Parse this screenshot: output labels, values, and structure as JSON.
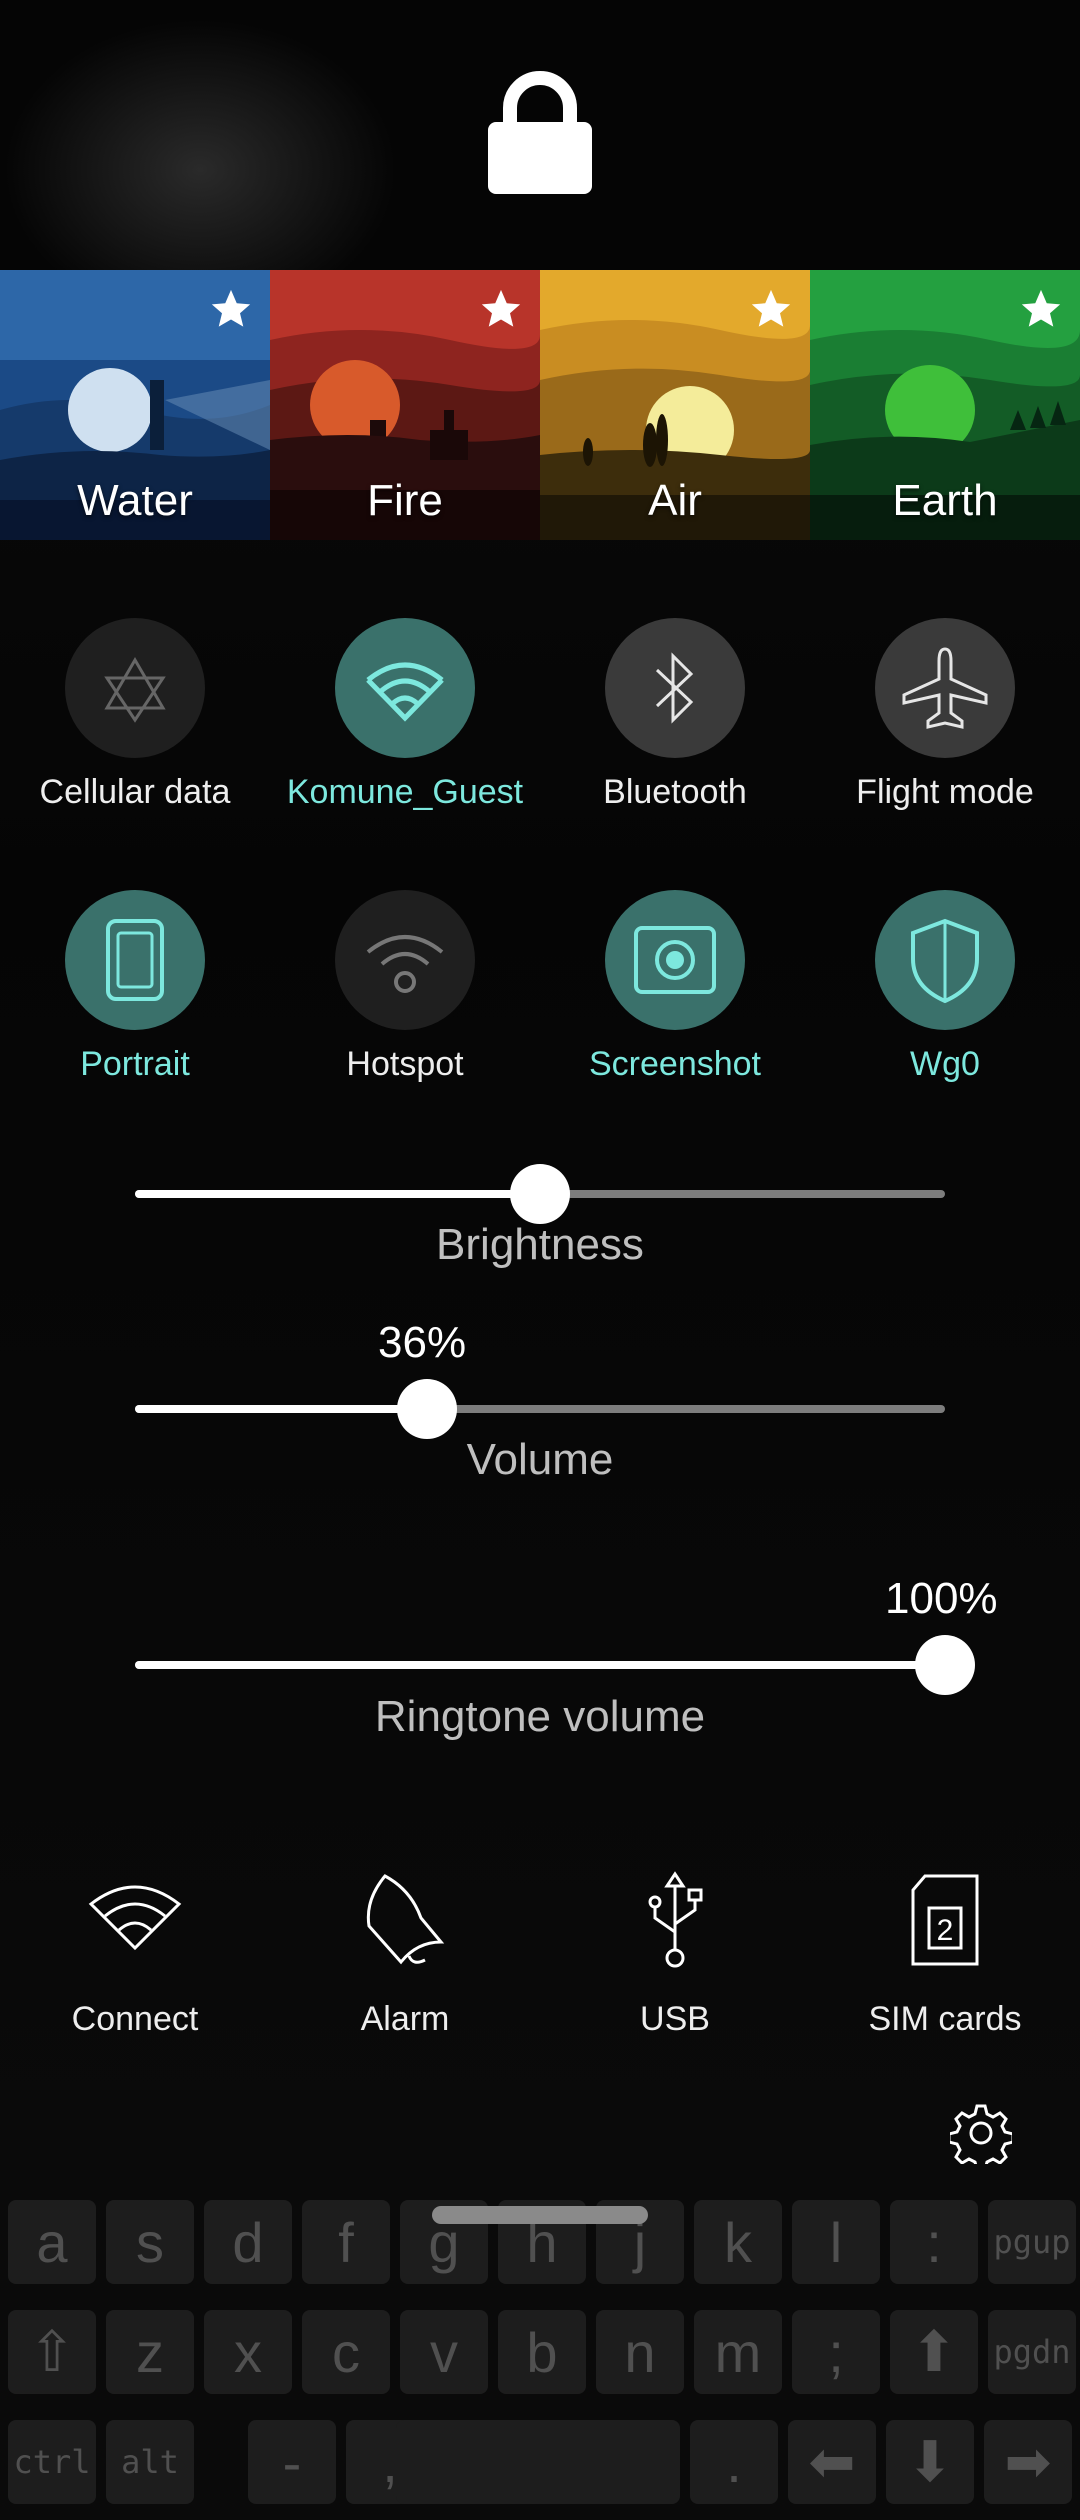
{
  "ambiences": [
    {
      "name": "Water",
      "colors": [
        "#1e3b66",
        "#0d1c33"
      ],
      "sun": "#cfe0f0"
    },
    {
      "name": "Fire",
      "colors": [
        "#a82a22",
        "#3a1010"
      ],
      "sun": "#e0622a"
    },
    {
      "name": "Air",
      "colors": [
        "#d9a12a",
        "#6a4a12"
      ],
      "sun": "#f4ec9a"
    },
    {
      "name": "Earth",
      "colors": [
        "#1f8a35",
        "#0c2a14"
      ],
      "sun": "#3fbf3a"
    }
  ],
  "quick_toggles": [
    {
      "label": "Cellular data",
      "icon": "cellular-data-icon",
      "state": "off"
    },
    {
      "label": "Komune_Guest",
      "icon": "wifi-icon",
      "state": "on"
    },
    {
      "label": "Bluetooth",
      "icon": "bluetooth-icon",
      "state": "dim"
    },
    {
      "label": "Flight mode",
      "icon": "flight-mode-icon",
      "state": "dim"
    },
    {
      "label": "Portrait",
      "icon": "portrait-icon",
      "state": "on"
    },
    {
      "label": "Hotspot",
      "icon": "hotspot-icon",
      "state": "off"
    },
    {
      "label": "Screenshot",
      "icon": "screenshot-icon",
      "state": "on"
    },
    {
      "label": "Wg0",
      "icon": "vpn-shield-icon",
      "state": "on"
    }
  ],
  "sliders": {
    "brightness": {
      "label": "Brightness",
      "level": 0.5
    },
    "volume": {
      "label": "Volume",
      "value_text": "36%",
      "level": 0.36
    },
    "ringtone": {
      "label": "Ringtone volume",
      "value_text": "100%",
      "level": 1.0
    }
  },
  "shortcuts": [
    {
      "label": "Connect",
      "icon": "connect-wifi-icon"
    },
    {
      "label": "Alarm",
      "icon": "alarm-bell-icon"
    },
    {
      "label": "USB",
      "icon": "usb-icon"
    },
    {
      "label": "SIM cards",
      "icon": "sim-card-icon",
      "badge": "2"
    }
  ],
  "colors": {
    "accent": "#7de8de",
    "toggle_on": "#3a716b"
  },
  "keyboard": {
    "row1": [
      "a",
      "s",
      "d",
      "f",
      "g",
      "h",
      "j",
      "k",
      "l",
      ":",
      "pgup"
    ],
    "row2": [
      "⇧",
      "z",
      "x",
      "c",
      "v",
      "b",
      "n",
      "m",
      ";",
      "⬆",
      "pgdn"
    ],
    "row3": [
      "ctrl",
      "alt",
      "-",
      ",",
      "",
      ".",
      "⬅",
      "⬇",
      "➡"
    ]
  }
}
